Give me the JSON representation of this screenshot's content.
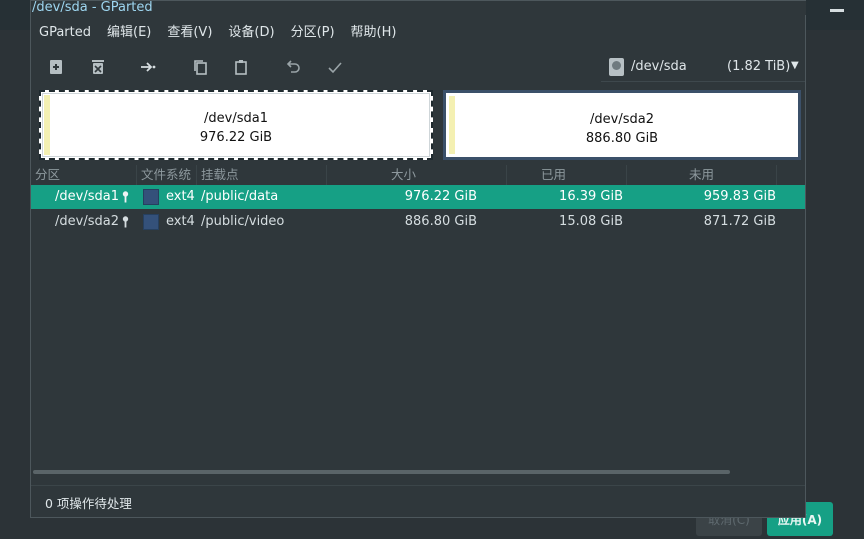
{
  "window": {
    "title": "/dev/sda - GParted"
  },
  "menu": [
    "GParted",
    "编辑(E)",
    "查看(V)",
    "设备(D)",
    "分区(P)",
    "帮助(H)"
  ],
  "toolbar": {
    "icons": [
      "new-partition-icon",
      "delete-partition-icon",
      "resize-move-icon",
      "copy-icon",
      "paste-icon",
      "undo-icon",
      "apply-icon"
    ]
  },
  "device": {
    "name": "/dev/sda",
    "size": "(1.82 TiB)"
  },
  "disk_map": [
    {
      "name": "/dev/sda1",
      "size": "976.22 GiB"
    },
    {
      "name": "/dev/sda2",
      "size": "886.80 GiB"
    }
  ],
  "table": {
    "headers": {
      "partition": "分区",
      "filesystem": "文件系统",
      "mountpoint": "挂载点",
      "size": "大小",
      "used": "已用",
      "unused": "未用"
    },
    "rows": [
      {
        "partition": "/dev/sda1",
        "filesystem": "ext4",
        "mountpoint": "/public/data",
        "size": "976.22 GiB",
        "used": "16.39 GiB",
        "unused": "959.83 GiB",
        "selected": true
      },
      {
        "partition": "/dev/sda2",
        "filesystem": "ext4",
        "mountpoint": "/public/video",
        "size": "886.80 GiB",
        "used": "15.08 GiB",
        "unused": "871.72 GiB",
        "selected": false
      }
    ]
  },
  "status": {
    "pending": "0 项操作待处理"
  },
  "background_app": {
    "cancel_label": "取消(C)",
    "apply_label": "应用(A)"
  },
  "colors": {
    "accent": "#16a085",
    "ext4": "#34517a",
    "used_fill": "#f4f0b2"
  }
}
